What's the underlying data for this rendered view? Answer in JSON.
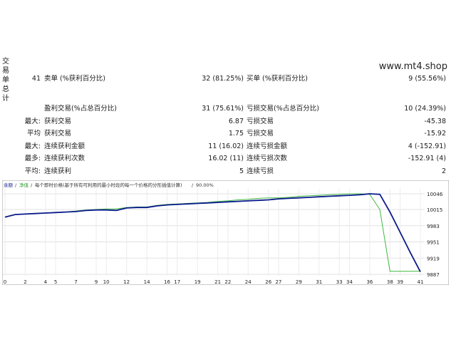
{
  "title_chars": [
    "交",
    "易",
    "单",
    "总",
    "计"
  ],
  "watermark": "www.mt4.shop",
  "rows": [
    {
      "l1": "41",
      "l2": "卖单 (%获利百分比)",
      "v1": "32 (81.25%)",
      "l3": "买单 (%获利百分比)",
      "v2": "9 (55.56%)"
    },
    {
      "l1": "",
      "l2": "盈利交易(%占总百分比)",
      "v1": "31 (75.61%)",
      "l3": "亏损交易(%占总百分比)",
      "v2": "10 (24.39%)"
    },
    {
      "l1": "最大:",
      "l2": "获利交易",
      "v1": "6.87",
      "l3": "亏损交易",
      "v2": "-45.38"
    },
    {
      "l1": "平均",
      "l2": "获利交易",
      "v1": "1.75",
      "l3": "亏损交易",
      "v2": "-15.92"
    },
    {
      "l1": "最大:",
      "l2": "连续获利金额",
      "v1": "11 (16.02)",
      "l3": "连续亏损金额",
      "v2": "4 (-152.91)"
    },
    {
      "l1": "最多:",
      "l2": "连续获利次数",
      "v1": "16.02 (11)",
      "l3": "连续亏损次数",
      "v2": "-152.91 (4)"
    },
    {
      "l1": "平均:",
      "l2": "连续获利",
      "v1": "5",
      "l3": "连续亏损",
      "v2": "2"
    }
  ],
  "chart_data": {
    "type": "line",
    "legend": [
      "余额",
      "净值",
      "每个即时价格(基于所有可利用的最小时段的每一个价格的分形插值计算)",
      "90.00%"
    ],
    "x_ticks": [
      0,
      2,
      4,
      5,
      7,
      9,
      10,
      12,
      14,
      16,
      17,
      19,
      21,
      22,
      24,
      26,
      27,
      29,
      31,
      33,
      34,
      36,
      38,
      39,
      41
    ],
    "y_ticks": [
      10046,
      10015,
      9983,
      9951,
      9919,
      9887
    ],
    "xlim": [
      0,
      41
    ],
    "ylim": [
      9887,
      10053
    ],
    "series": [
      {
        "color": "#0a1a8c",
        "values": [
          [
            0,
            10000
          ],
          [
            1,
            10005
          ],
          [
            2,
            10006
          ],
          [
            3,
            10007
          ],
          [
            4,
            10008
          ],
          [
            5,
            10009
          ],
          [
            6,
            10010
          ],
          [
            7,
            10011
          ],
          [
            8,
            10013
          ],
          [
            9,
            10014
          ],
          [
            10,
            10014
          ],
          [
            11,
            10013
          ],
          [
            12,
            10018
          ],
          [
            13,
            10019
          ],
          [
            14,
            10019
          ],
          [
            15,
            10022
          ],
          [
            16,
            10024
          ],
          [
            17,
            10025
          ],
          [
            18,
            10026
          ],
          [
            19,
            10027
          ],
          [
            20,
            10028
          ],
          [
            21,
            10029
          ],
          [
            22,
            10030
          ],
          [
            23,
            10031
          ],
          [
            24,
            10032
          ],
          [
            25,
            10033
          ],
          [
            26,
            10034
          ],
          [
            27,
            10036
          ],
          [
            28,
            10037
          ],
          [
            29,
            10038
          ],
          [
            30,
            10039
          ],
          [
            31,
            10040
          ],
          [
            32,
            10041
          ],
          [
            33,
            10042
          ],
          [
            34,
            10043
          ],
          [
            35,
            10044
          ],
          [
            36,
            10046
          ],
          [
            37,
            10045
          ],
          [
            38,
            10010
          ],
          [
            39,
            9970
          ],
          [
            40,
            9930
          ],
          [
            41,
            9892
          ]
        ]
      },
      {
        "color": "#3fb83f",
        "values": [
          [
            0,
            10000
          ],
          [
            1,
            10005
          ],
          [
            2,
            10006
          ],
          [
            3,
            10007
          ],
          [
            4,
            10008
          ],
          [
            5,
            10009
          ],
          [
            6,
            10010
          ],
          [
            7,
            10012
          ],
          [
            8,
            10014
          ],
          [
            9,
            10015
          ],
          [
            10,
            10016
          ],
          [
            11,
            10016
          ],
          [
            12,
            10019
          ],
          [
            13,
            10020
          ],
          [
            14,
            10020
          ],
          [
            15,
            10023
          ],
          [
            16,
            10025
          ],
          [
            17,
            10026
          ],
          [
            18,
            10027
          ],
          [
            19,
            10028
          ],
          [
            20,
            10029
          ],
          [
            21,
            10031
          ],
          [
            22,
            10032
          ],
          [
            23,
            10034
          ],
          [
            24,
            10035
          ],
          [
            25,
            10037
          ],
          [
            26,
            10038
          ],
          [
            27,
            10038
          ],
          [
            28,
            10039
          ],
          [
            29,
            10041
          ],
          [
            30,
            10042
          ],
          [
            31,
            10043
          ],
          [
            32,
            10044
          ],
          [
            33,
            10045
          ],
          [
            34,
            10046
          ],
          [
            35,
            10046
          ],
          [
            36,
            10045
          ],
          [
            37,
            10015
          ],
          [
            38,
            9893
          ],
          [
            39,
            9893
          ],
          [
            40,
            9893
          ],
          [
            41,
            9893
          ]
        ]
      }
    ]
  }
}
